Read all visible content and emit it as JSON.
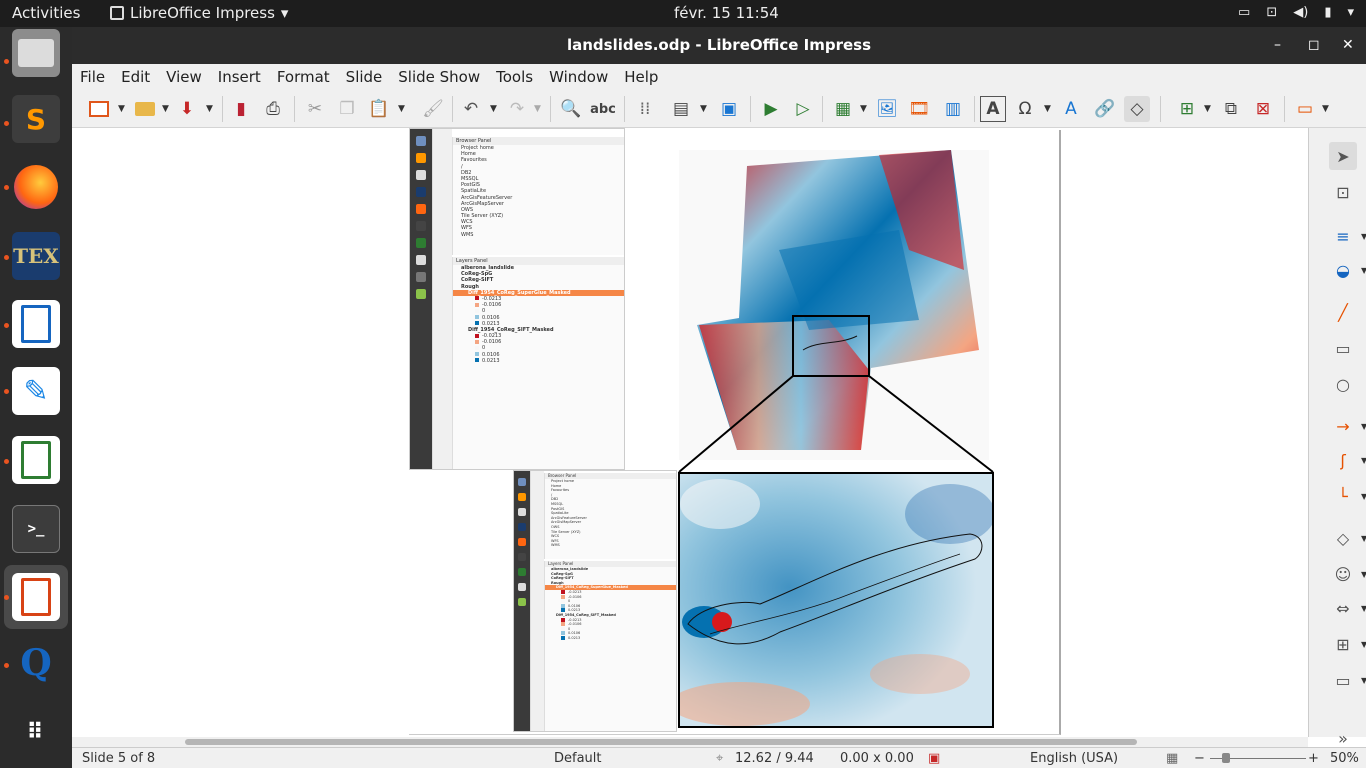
{
  "topbar": {
    "activities": "Activities",
    "app_name": "LibreOffice Impress",
    "clock": "févr. 15  11:54",
    "tray_icons": [
      "keyboard-icon",
      "network-icon",
      "volume-icon",
      "battery-icon",
      "power-menu-icon"
    ]
  },
  "dock": {
    "apps": [
      "Files",
      "Sublime Text",
      "Firefox",
      "TeXworks",
      "LibreOffice Writer",
      "Text Editor",
      "LibreOffice Calc",
      "Terminal",
      "LibreOffice Impress",
      "Okular"
    ],
    "show_apps": "Show Applications"
  },
  "window": {
    "title": "landslides.odp - LibreOffice Impress",
    "minimize": "–",
    "maximize": "◻",
    "close": "✕"
  },
  "menu": {
    "items": [
      "File",
      "Edit",
      "View",
      "Insert",
      "Format",
      "Slide",
      "Slide Show",
      "Tools",
      "Window",
      "Help"
    ]
  },
  "toolbar": {
    "spellcheck_label": "abc"
  },
  "qgis": {
    "browser_title": "Browser Panel",
    "browser_items": [
      "Project home",
      "Home",
      "Favourites",
      "/",
      "DB2",
      "MSSQL",
      "PostGIS",
      "SpatiaLite",
      "ArcGisFeatureServer",
      "ArcGisMapServer",
      "OWS",
      "Tile Server (XYZ)",
      "WCS",
      "WFS",
      "WMS"
    ],
    "layers_title": "Layers Panel",
    "layers": [
      {
        "label": "alberona_landslide",
        "indent": 0,
        "highlight": false
      },
      {
        "label": "CoReg-SpG",
        "indent": 0,
        "highlight": false
      },
      {
        "label": "CoReg-SIFT",
        "indent": 0,
        "highlight": false
      },
      {
        "label": "Rough",
        "indent": 0,
        "highlight": false
      },
      {
        "label": "Diff_1954_CoReg_SuperGlue_Masked",
        "indent": 1,
        "highlight": true
      },
      {
        "label": "-0.0213",
        "indent": 2,
        "highlight": false,
        "swatch": "#c0111f"
      },
      {
        "label": "-0.0106",
        "indent": 2,
        "highlight": false,
        "swatch": "#f4a582"
      },
      {
        "label": "0",
        "indent": 2,
        "highlight": false,
        "swatch": "#f7f7f7"
      },
      {
        "label": "0.0106",
        "indent": 2,
        "highlight": false,
        "swatch": "#92c5de"
      },
      {
        "label": "0.0213",
        "indent": 2,
        "highlight": false,
        "swatch": "#0571b0"
      },
      {
        "label": "Diff_1954_CoReg_SIFT_Masked",
        "indent": 1,
        "highlight": false
      },
      {
        "label": "-0.0213",
        "indent": 2,
        "highlight": false,
        "swatch": "#c0111f"
      },
      {
        "label": "-0.0106",
        "indent": 2,
        "highlight": false,
        "swatch": "#f4a582"
      },
      {
        "label": "0",
        "indent": 2,
        "highlight": false,
        "swatch": "#f7f7f7"
      },
      {
        "label": "0.0106",
        "indent": 2,
        "highlight": false,
        "swatch": "#92c5de"
      },
      {
        "label": "0.0213",
        "indent": 2,
        "highlight": false,
        "swatch": "#0571b0"
      }
    ]
  },
  "colors": {
    "diverging_red": "#d7191c",
    "diverging_lightred": "#f4a582",
    "diverging_white": "#f7f7f7",
    "diverging_lightblue": "#92c5de",
    "diverging_blue": "#0571b0",
    "qgis_highlight": "#f58646"
  },
  "statusbar": {
    "slide": "Slide 5 of 8",
    "master": "Default",
    "position": "12.62 / 9.44",
    "size": "0.00 x 0.00",
    "language": "English (USA)",
    "zoom": "50%"
  }
}
